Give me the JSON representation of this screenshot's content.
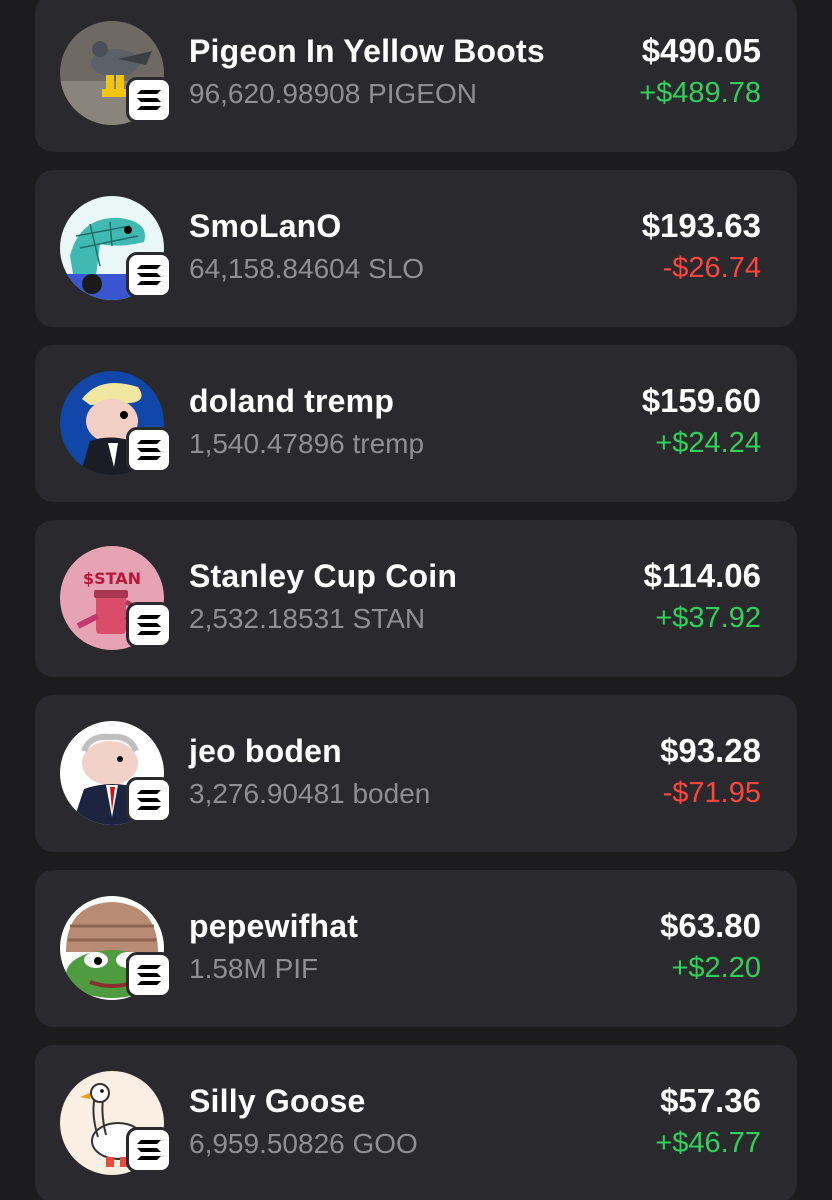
{
  "colors": {
    "background": "#1c1c1e",
    "card": "#2a2a2e",
    "positive": "#30d158",
    "negative": "#ff453a",
    "secondary_text": "#8e8e93"
  },
  "tokens": [
    {
      "name": "Pigeon In Yellow Boots",
      "amount": "96,620.98908 PIGEON",
      "value": "$490.05",
      "change": "+$489.78",
      "direction": "up",
      "avatar_icon": "pigeon-icon",
      "chain_icon": "solana-icon"
    },
    {
      "name": "SmoLanO",
      "amount": "64,158.84604 SLO",
      "value": "$193.63",
      "change": "-$26.74",
      "direction": "down",
      "avatar_icon": "lizard-icon",
      "chain_icon": "solana-icon"
    },
    {
      "name": "doland tremp",
      "amount": "1,540.47896 tremp",
      "value": "$159.60",
      "change": "+$24.24",
      "direction": "up",
      "avatar_icon": "tremp-icon",
      "chain_icon": "solana-icon"
    },
    {
      "name": "Stanley Cup Coin",
      "amount": "2,532.18531 STAN",
      "value": "$114.06",
      "change": "+$37.92",
      "direction": "up",
      "avatar_icon": "stanley-cup-icon",
      "avatar_text": "$STAN",
      "chain_icon": "solana-icon"
    },
    {
      "name": "jeo boden",
      "amount": "3,276.90481 boden",
      "value": "$93.28",
      "change": "-$71.95",
      "direction": "down",
      "avatar_icon": "boden-icon",
      "chain_icon": "solana-icon"
    },
    {
      "name": "pepewifhat",
      "amount": "1.58M PIF",
      "value": "$63.80",
      "change": "+$2.20",
      "direction": "up",
      "avatar_icon": "pepe-icon",
      "chain_icon": "solana-icon"
    },
    {
      "name": "Silly Goose",
      "amount": "6,959.50826 GOO",
      "value": "$57.36",
      "change": "+$46.77",
      "direction": "up",
      "avatar_icon": "goose-icon",
      "chain_icon": "solana-icon"
    }
  ]
}
